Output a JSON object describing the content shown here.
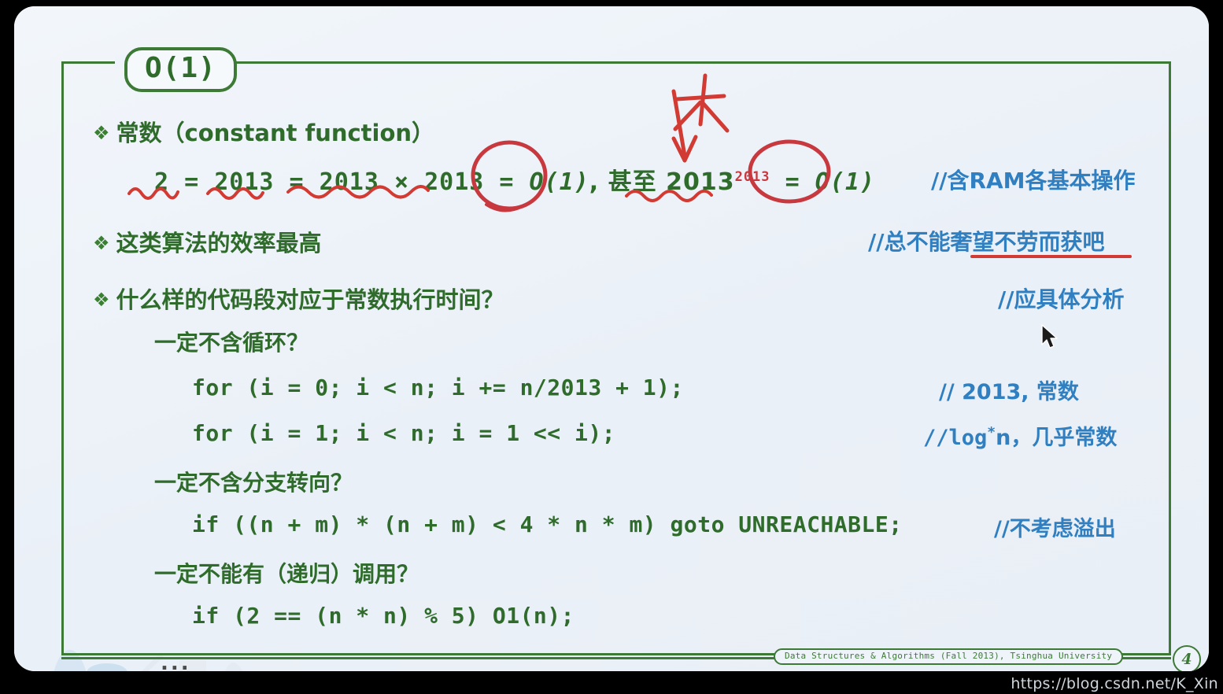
{
  "slide": {
    "title": "O(1)",
    "page_number": "4",
    "footer": "Data Structures & Algorithms (Fall 2013), Tsinghua University",
    "trailing_dots": "...",
    "watermark": "https://blog.csdn.net/K_Xin"
  },
  "colors": {
    "green": "#2f6b2b",
    "frame_green": "#3d7a35",
    "blue": "#2f7fc1",
    "red_ink": "#c8393f",
    "slide_bg": "#eef3f9"
  },
  "bullets": {
    "b1": "常数（constant function）",
    "b2": "这类算法的效率最高",
    "b3": "什么样的代码段对应于常数执行时间？"
  },
  "equation": {
    "lhs": "2 = 2013 = 2013 × 2013 = ",
    "circled1": "O(1)",
    "mid": ", 甚至  2013",
    "superscript": "2013",
    "eq": " = ",
    "circled2": "O(1)"
  },
  "questions": {
    "q1": "一定不含循环？",
    "q2": "一定不含分支转向？",
    "q3": "一定不能有（递归）调用？"
  },
  "code": {
    "line1": "for (i = 0; i < n; i += n/2013 + 1);",
    "line2": "for (i = 1; i < n; i = 1 << i);",
    "line3": "if ((n + m) * (n + m) < 4 * n * m) goto UNREACHABLE;",
    "line4": "if (2 == (n * n) % 5) O1(n);"
  },
  "comments": {
    "c1": "//含RAM各基本操作",
    "c2": "//总不能奢望不劳而获吧",
    "c3": "//应具体分析",
    "c4": "// 2013, 常数",
    "c5_prefix": "//log",
    "c5_star": "*",
    "c5_suffix": "n，几乎常数",
    "c6": "//不考虑溢出"
  },
  "ink": {
    "handwritten_char": "大",
    "arrow": "down-arrow-annotation",
    "squiggle_count": 4,
    "circle_count": 2,
    "underline": "red-straight-underline"
  }
}
